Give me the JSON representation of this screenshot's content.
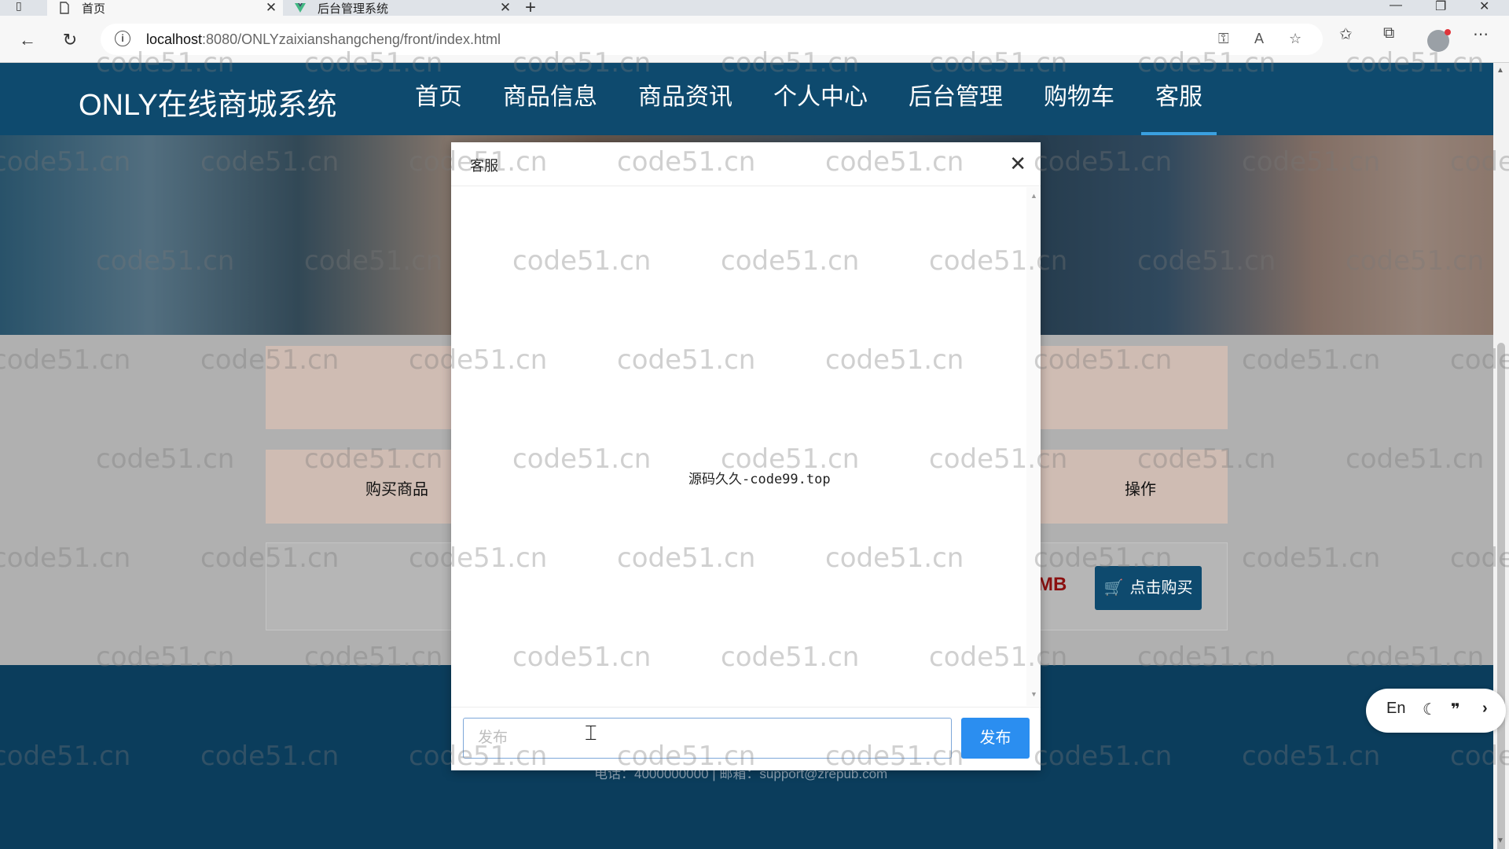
{
  "browser": {
    "tabs": [
      {
        "title": "首页",
        "active": true
      },
      {
        "title": "后台管理系统",
        "active": false
      }
    ],
    "url_host": "localhost",
    "url_rest": ":8080/ONLYzaixianshangcheng/front/index.html"
  },
  "site": {
    "title": "ONLY在线商城系统",
    "nav": [
      "首页",
      "商品信息",
      "商品资讯",
      "个人中心",
      "后台管理",
      "购物车",
      "客服"
    ],
    "active_nav": "客服",
    "labels": {
      "buy_goods": "购买商品",
      "operation": "操作",
      "price_tail": "MB",
      "buy_button": "点击购买"
    },
    "footer_text": "电话：4000000000 | 邮箱：support@zrepub.com"
  },
  "modal": {
    "title": "客服",
    "message": "源码久久-code99.top",
    "input_placeholder": "发布",
    "send_label": "发布"
  },
  "float_widget": {
    "lang": "En"
  },
  "watermark": "code51.cn",
  "colors": {
    "header_bg": "#0e4a6e",
    "send_button": "#2b8ef0",
    "price": "#8b1010"
  }
}
